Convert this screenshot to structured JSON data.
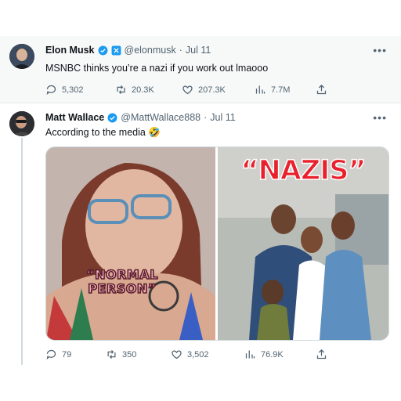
{
  "tweet1": {
    "name": "Elon Musk",
    "handle": "@elonmusk",
    "date": "Jul 11",
    "text": "MSNBC thinks you’re a nazi if you work out lmaooo",
    "replies": "5,302",
    "retweets": "20.3K",
    "likes": "207.3K",
    "views": "7.7M"
  },
  "tweet2": {
    "name": "Matt Wallace",
    "handle": "@MattWallace888",
    "date": "Jul 11",
    "text": "According to the media 🤣",
    "media": {
      "left_caption": "“NORMAL PERSON”",
      "right_caption": "“NAZIS”"
    },
    "replies": "79",
    "retweets": "350",
    "likes": "3,502",
    "views": "76.9K"
  },
  "icons": {
    "more": "more-icon",
    "verified": "verified-badge-icon",
    "reply": "reply-icon",
    "retweet": "retweet-icon",
    "like": "heart-icon",
    "views": "views-icon",
    "share": "share-icon"
  },
  "colors": {
    "verified_blue": "#1d9bf0",
    "gold_badge": "#e2b719",
    "muted": "#536471",
    "highlight_bg": "#f7f9f9"
  }
}
